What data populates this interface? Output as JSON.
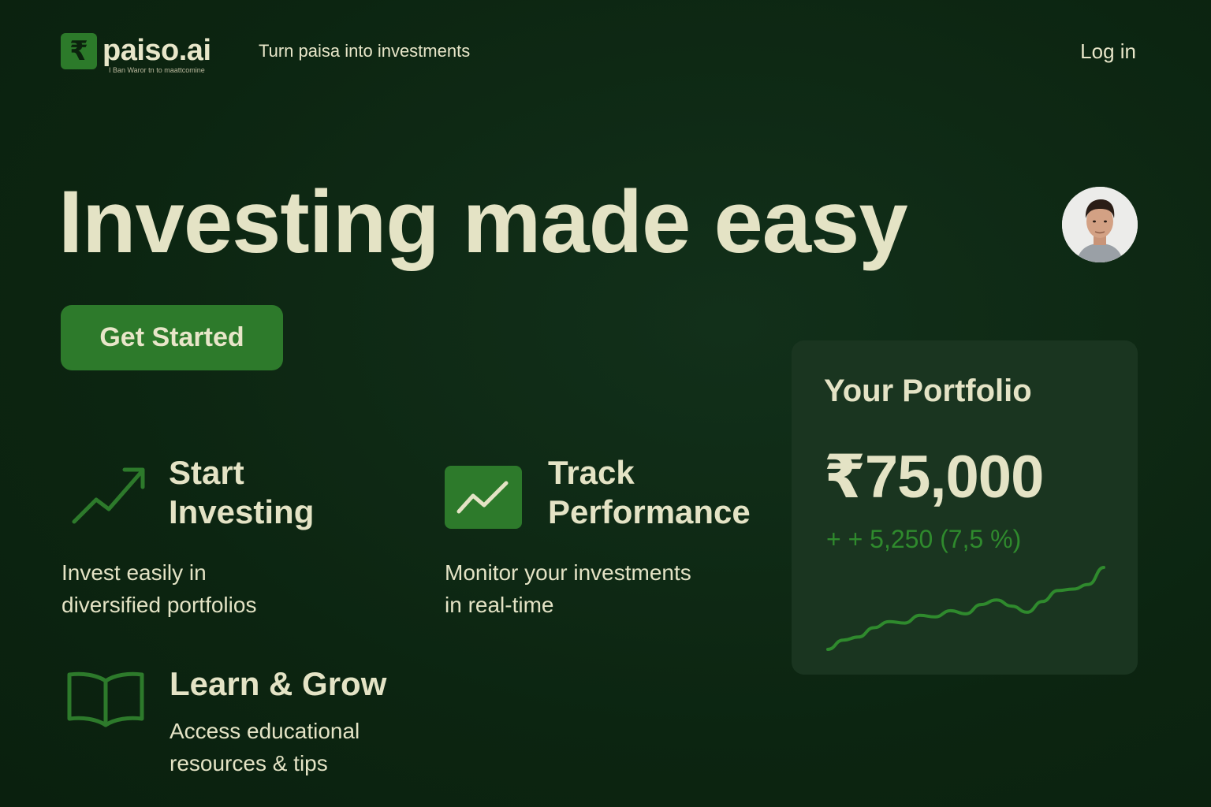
{
  "header": {
    "logo_symbol": "₹",
    "logo_name": "paiso.ai",
    "logo_sub": "I Ban Waror tn to maattcomine",
    "tagline": "Turn paisa into investments",
    "login_label": "Log in"
  },
  "hero": {
    "title": "Investing made easy",
    "cta_label": "Get Started"
  },
  "features": [
    {
      "title_line1": "Start",
      "title_line2": "Investing",
      "desc_line1": "Invest easily in",
      "desc_line2": "diversified portfolios",
      "icon": "trending-up-icon"
    },
    {
      "title_line1": "Track",
      "title_line2": "Performance",
      "desc_line1": "Monitor your investments",
      "desc_line2": "in real-time",
      "icon": "chart-line-icon"
    },
    {
      "title_line1": "Learn & Grow",
      "desc_line1": "Access educational",
      "desc_line2": "resources & tips",
      "icon": "book-icon"
    }
  ],
  "portfolio": {
    "title": "Your Portfolio",
    "value": "₹75,000",
    "change": "+ + 5,250 (7,5 %)"
  },
  "colors": {
    "background": "#0e2a10",
    "accent": "#2d7a2b",
    "text": "#e4e3c5",
    "card": "#1a3520"
  },
  "sparkline": {
    "values": [
      2,
      8,
      10,
      16,
      20,
      19,
      24,
      23,
      27,
      25,
      31,
      34,
      30,
      26,
      33,
      40,
      41,
      44,
      55
    ]
  }
}
